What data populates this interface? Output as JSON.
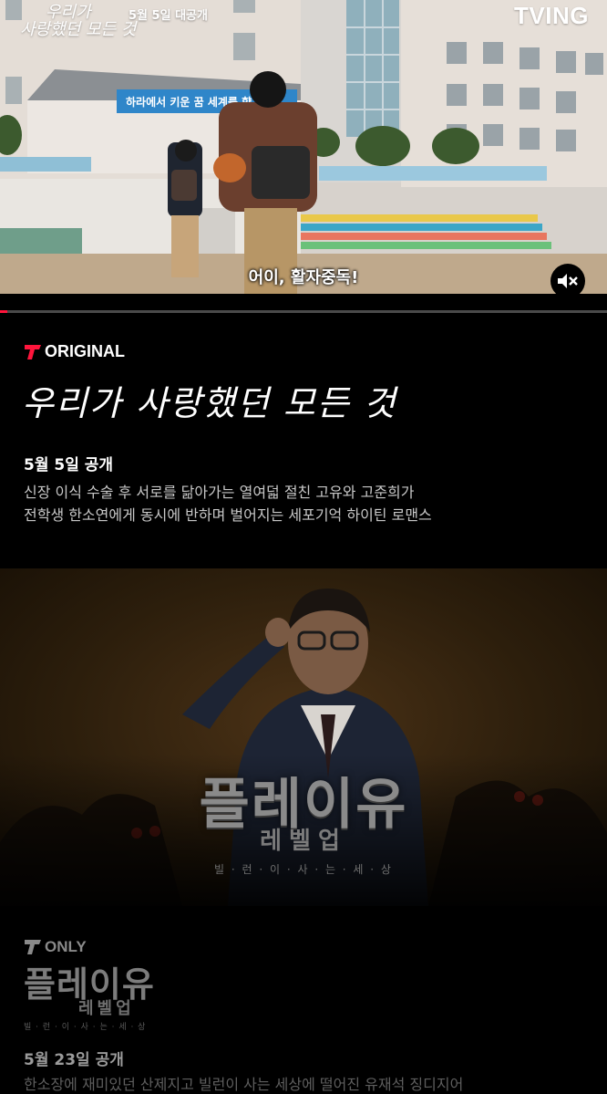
{
  "hero": {
    "title_logo_line1": "우리가",
    "title_logo_line2": "사랑했던 모든 것",
    "release_badge": "5월 5일 대공개",
    "brand": "TVING",
    "banner_text": "하라에서 키운 꿈 세계를 향",
    "subtitle": "어이, 활자중독!",
    "mute_icon": "volume-mute-icon",
    "progress": 0.012
  },
  "featured": {
    "badge": "ORIGINAL",
    "title": "우리가 사랑했던 모든 것",
    "date": "5월 5일 공개",
    "description_line1": "신장 이식 수술 후 서로를 닮아가는 열여덟 절친 고유와 고준희가",
    "description_line2": "전학생 한소연에게 동시에 반하며 벌어지는 세포기억 하이틴 로맨스"
  },
  "next": {
    "poster_title": "플레이유",
    "poster_level": "레벨업",
    "poster_tagline": "빌 · 런 · 이 · 사 · 는 · 세 · 상",
    "badge": "ONLY",
    "logo_title": "플레이유",
    "logo_level": "레벨업",
    "logo_tagline": "빌 · 런 · 이 · 사 · 는 · 세 · 상",
    "date": "5월 23일 공개",
    "description_partial": "한소장에 재미있던 산제지고 빌런이 사는 세상에 떨어진 유재석 징디지어"
  },
  "colors": {
    "accent": "#ff153c",
    "background": "#000000",
    "banner": "#2f86c9"
  }
}
